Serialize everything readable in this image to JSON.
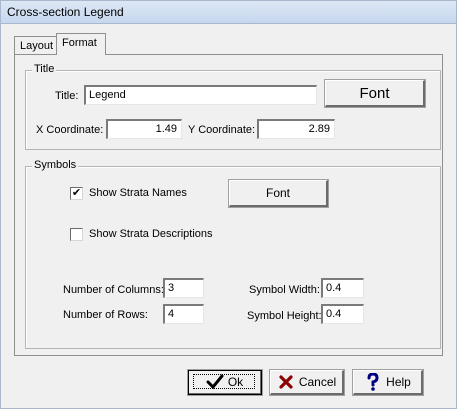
{
  "window": {
    "title": "Cross-section Legend"
  },
  "tabs": [
    {
      "label": "Layout",
      "active": false
    },
    {
      "label": "Format",
      "active": true
    }
  ],
  "title_group": {
    "label": "Title",
    "title_label": "Title:",
    "title_value": "Legend",
    "font_button": "Font",
    "x_label": "X Coordinate:",
    "x_value": "1.49",
    "y_label": "Y Coordinate:",
    "y_value": "2.89"
  },
  "symbols_group": {
    "label": "Symbols",
    "show_names_label": "Show Strata Names",
    "show_names_checked": true,
    "show_names_mark": "✔",
    "font_button": "Font",
    "show_desc_label": "Show Strata Descriptions",
    "show_desc_checked": false,
    "columns_label": "Number of Columns:",
    "columns_value": "3",
    "rows_label": "Number of Rows:",
    "rows_value": "4",
    "width_label": "Symbol Width:",
    "width_value": "0.4",
    "height_label": "Symbol Height:",
    "height_value": "0.4"
  },
  "buttons": {
    "ok": "Ok",
    "cancel": "Cancel",
    "help": "Help"
  },
  "icons": {
    "ok": "checkmark-icon",
    "cancel": "x-icon",
    "help": "question-icon"
  },
  "colors": {
    "titlebar": "#c7d8ee",
    "ok_check": "#000000",
    "cancel_x": "#8b0000",
    "help_q": "#000080"
  }
}
